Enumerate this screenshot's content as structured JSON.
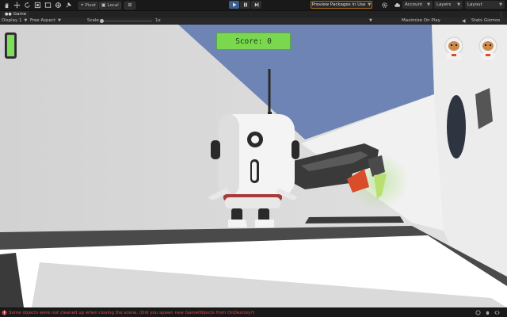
{
  "toolbar": {
    "tools": [
      "hand-icon",
      "move-icon",
      "rotate-icon",
      "scale-icon",
      "rect-icon",
      "transform-icon",
      "custom-tool-icon"
    ],
    "pivot_label": "Pivot",
    "local_label": "Local",
    "preview_packages_label": "Preview Packages in Use",
    "account_label": "Account",
    "layers_label": "Layers",
    "layout_label": "Layout"
  },
  "tab": {
    "title": "Game"
  },
  "game_controls": {
    "display": "Display 1",
    "aspect": "Free Aspect",
    "scale_label": "Scale",
    "scale_value": "1x",
    "maximize_label": "Maximize On Play",
    "stats_label": "Stats",
    "gizmos_label": "Gizmos"
  },
  "game": {
    "score_text": "Score: 0",
    "battery_level": 1.0,
    "lives": 2
  },
  "status": {
    "message": "Some objects were not cleaned up when closing the scene. (Did you spawn new GameObjects from OnDestroy?)"
  },
  "colors": {
    "accent_play": "#3c5e8c",
    "warning_border": "#a36a12",
    "error_text": "#e04b4b",
    "score_bg": "#79d84e"
  }
}
